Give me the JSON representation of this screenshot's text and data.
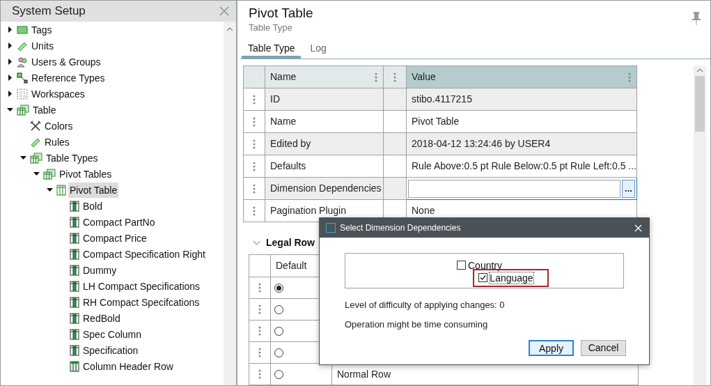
{
  "side_panel": {
    "title": "System Setup"
  },
  "tree": [
    {
      "label": "Tags",
      "kind": "tag",
      "expanded": false,
      "selected": false
    },
    {
      "label": "Units",
      "kind": "ruler",
      "expanded": false,
      "selected": false
    },
    {
      "label": "Users & Groups",
      "kind": "users",
      "expanded": false,
      "selected": false
    },
    {
      "label": "Reference Types",
      "kind": "reference",
      "expanded": false,
      "selected": false
    },
    {
      "label": "Workspaces",
      "kind": "grid",
      "expanded": false,
      "selected": false
    },
    {
      "label": "Table",
      "kind": "tables",
      "expanded": true,
      "selected": false,
      "children": [
        {
          "label": "Colors",
          "kind": "tools",
          "selected": false
        },
        {
          "label": "Rules",
          "kind": "ruler",
          "selected": false
        },
        {
          "label": "Table Types",
          "kind": "tables",
          "expanded": true,
          "selected": false,
          "children": [
            {
              "label": "Pivot Tables",
              "kind": "tables",
              "expanded": true,
              "selected": false,
              "children": [
                {
                  "label": "Pivot Table",
                  "kind": "table",
                  "expanded": true,
                  "selected": true,
                  "children": [
                    {
                      "label": "Bold",
                      "kind": "table-filled",
                      "selected": false
                    },
                    {
                      "label": "Compact PartNo",
                      "kind": "table-filled",
                      "selected": false
                    },
                    {
                      "label": "Compact Price",
                      "kind": "table-filled",
                      "selected": false
                    },
                    {
                      "label": "Compact Specification Right",
                      "kind": "table-filled",
                      "selected": false
                    },
                    {
                      "label": "Dummy",
                      "kind": "table-filled",
                      "selected": false
                    },
                    {
                      "label": "LH Compact Specifications",
                      "kind": "table-filled",
                      "selected": false
                    },
                    {
                      "label": "RH Compact Specifcations",
                      "kind": "table-filled",
                      "selected": false
                    },
                    {
                      "label": "RedBold",
                      "kind": "table-filled",
                      "selected": false
                    },
                    {
                      "label": "Spec Column",
                      "kind": "table-filled",
                      "selected": false
                    },
                    {
                      "label": "Specification",
                      "kind": "table-filled",
                      "selected": false
                    },
                    {
                      "label": "Column Header Row",
                      "kind": "table-light",
                      "selected": false
                    }
                  ]
                }
              ]
            }
          ]
        }
      ]
    }
  ],
  "editor": {
    "title": "Pivot Table",
    "subtitle": "Table Type",
    "tabs": [
      {
        "label": "Table Type",
        "selected": true
      },
      {
        "label": "Log",
        "selected": false
      }
    ],
    "properties": {
      "columns": [
        "Name",
        "Value"
      ],
      "rows": [
        {
          "name": "ID",
          "kind": "text",
          "value": "stibo.4117215"
        },
        {
          "name": "Name",
          "kind": "text",
          "value": "Pivot Table"
        },
        {
          "name": "Edited by",
          "kind": "text",
          "value": "2018-04-12 13:24:46 by USER4"
        },
        {
          "name": "Defaults",
          "kind": "text",
          "value": "Rule Above:0.5 pt Rule Below:0.5 pt Rule Left:0.5 ..."
        },
        {
          "name": "Dimension Dependencies",
          "kind": "field",
          "button": "..."
        },
        {
          "name": "Pagination Plugin",
          "kind": "text",
          "value": "None"
        }
      ]
    },
    "legal_rows": {
      "title": "Legal Row",
      "expanded": true,
      "columns": [
        "Default"
      ],
      "rows": [
        {
          "selected": true
        },
        {
          "selected": false
        },
        {
          "selected": false
        },
        {
          "selected": false
        },
        {
          "selected": false,
          "column_2": "Normal Row"
        }
      ]
    }
  },
  "dialog": {
    "title": "Select Dimension Dependencies",
    "options": [
      {
        "label": "Country",
        "checked": false,
        "highlighted": false
      },
      {
        "label": "Language",
        "checked": true,
        "highlighted": true
      }
    ],
    "messages": [
      "Level of difficulty of applying changes: 0",
      "Operation might be time consuming"
    ],
    "buttons": [
      {
        "label": "Apply",
        "default": true
      },
      {
        "label": "Cancel",
        "default": false
      }
    ]
  }
}
